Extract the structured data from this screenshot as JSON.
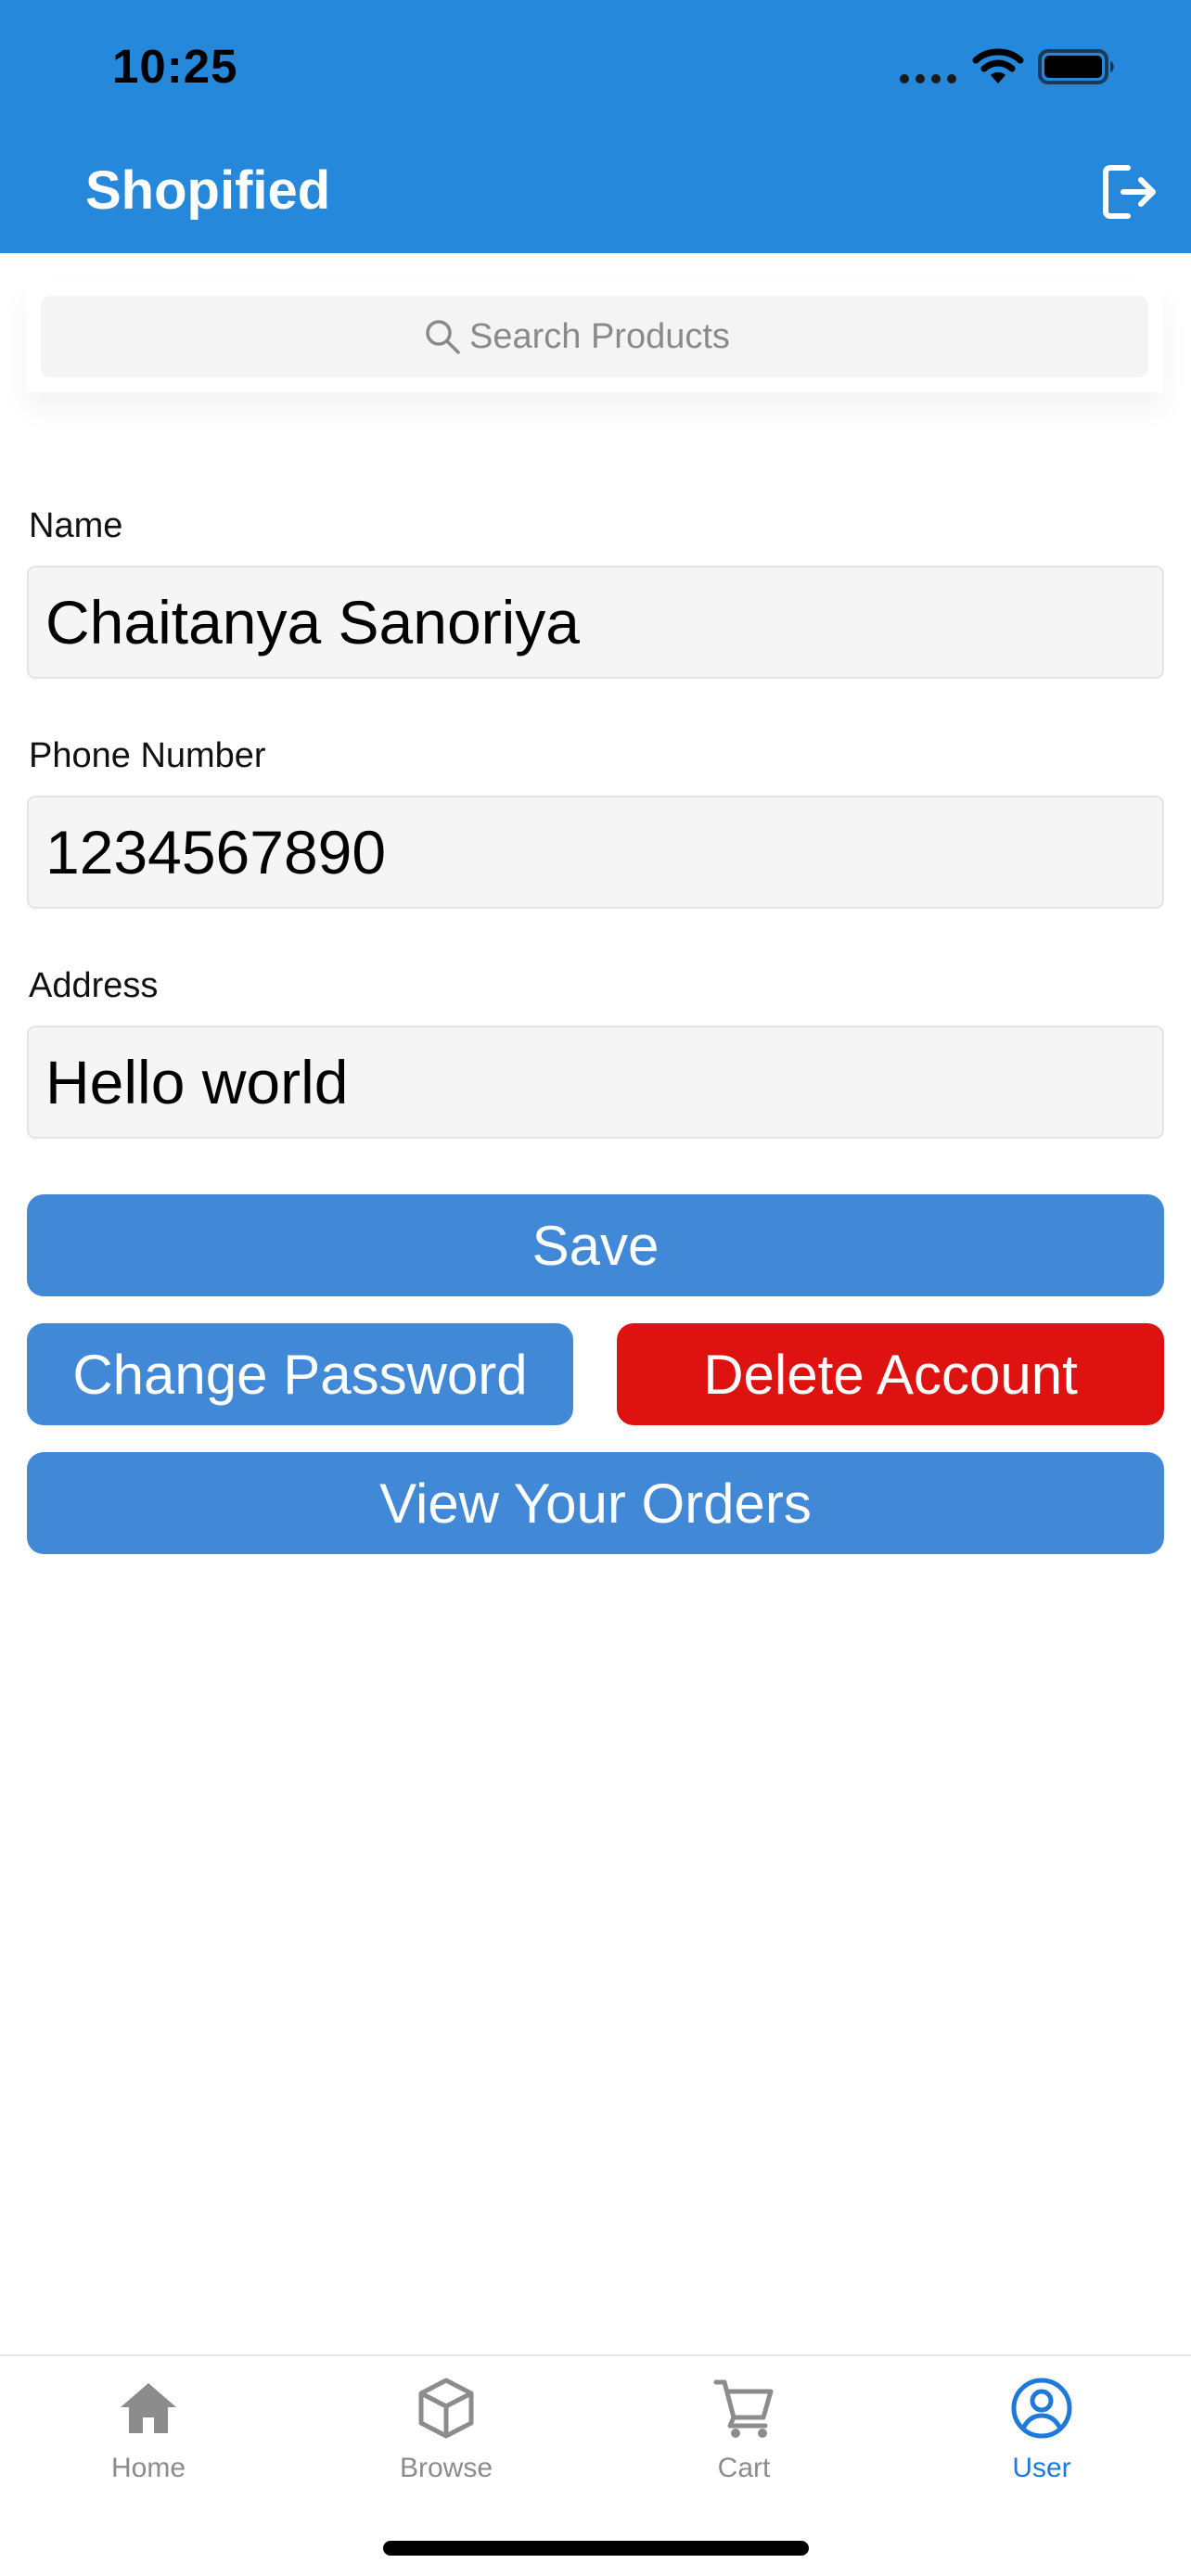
{
  "status_bar": {
    "time": "10:25",
    "icons": [
      "signal-dots-icon",
      "wifi-icon",
      "battery-icon"
    ]
  },
  "header": {
    "title": "Shopified",
    "logout_icon": "logout-icon",
    "background_color": "#2688da"
  },
  "search": {
    "placeholder": "Search Products",
    "icon": "search-icon"
  },
  "form": {
    "name": {
      "label": "Name",
      "value": "Chaitanya Sanoriya"
    },
    "phone": {
      "label": "Phone Number",
      "value": "1234567890"
    },
    "address": {
      "label": "Address",
      "value": "Hello world"
    }
  },
  "buttons": {
    "save": "Save",
    "change_password": "Change Password",
    "delete_account": "Delete Account",
    "view_orders": "View Your Orders",
    "primary_color": "#4189d6",
    "danger_color": "#df1212"
  },
  "tabbar": {
    "active": "User",
    "active_color": "#1f79d8",
    "inactive_color": "#8c8c8c",
    "items": [
      {
        "label": "Home",
        "icon": "home-icon"
      },
      {
        "label": "Browse",
        "icon": "cube-icon"
      },
      {
        "label": "Cart",
        "icon": "cart-icon"
      },
      {
        "label": "User",
        "icon": "user-icon"
      }
    ]
  }
}
